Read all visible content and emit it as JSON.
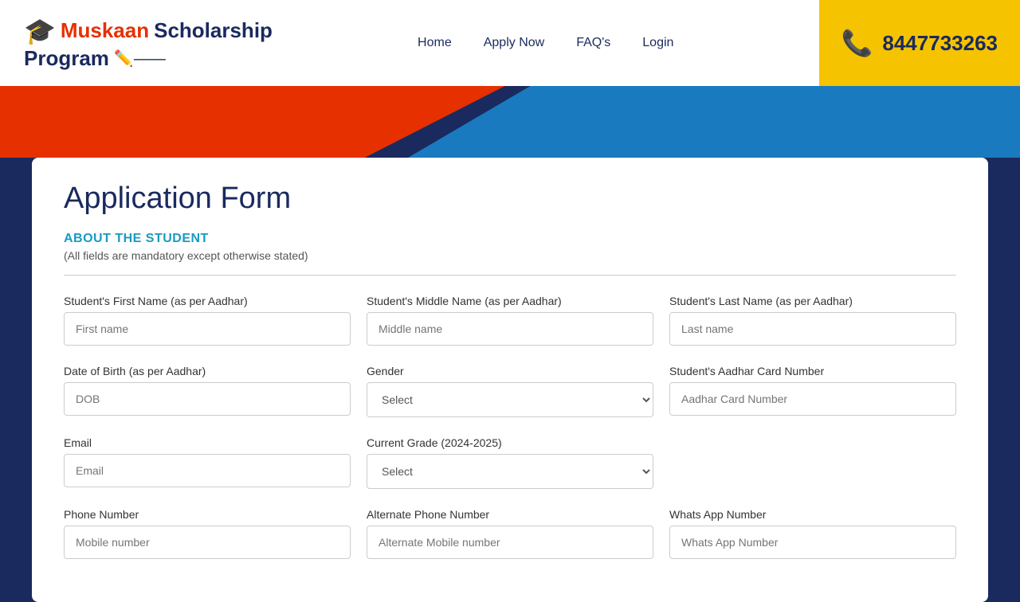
{
  "header": {
    "logo": {
      "muskaan": "Muskaan",
      "scholarship": "Scholarship",
      "program": "Program",
      "cap_icon": "🎓",
      "pencil_icon": "✏️"
    },
    "nav": {
      "items": [
        {
          "label": "Home",
          "active": false
        },
        {
          "label": "Apply Now",
          "active": true
        },
        {
          "label": "FAQ's",
          "active": false
        },
        {
          "label": "Login",
          "active": false
        }
      ]
    },
    "phone": {
      "number": "8447733263",
      "phone_icon": "📞"
    }
  },
  "form": {
    "title": "Application Form",
    "section_title": "ABOUT THE STUDENT",
    "section_note": "(All fields are mandatory except otherwise stated)",
    "fields": {
      "first_name_label": "Student's First Name (as per Aadhar)",
      "first_name_placeholder": "First name",
      "middle_name_label": "Student's Middle Name (as per Aadhar)",
      "middle_name_placeholder": "Middle name",
      "last_name_label": "Student's Last Name (as per Aadhar)",
      "last_name_placeholder": "Last name",
      "dob_label": "Date of Birth (as per Aadhar)",
      "dob_placeholder": "DOB",
      "gender_label": "Gender",
      "gender_placeholder": "Select",
      "aadhar_label": "Student's Aadhar Card Number",
      "aadhar_placeholder": "Aadhar Card Number",
      "email_label": "Email",
      "email_placeholder": "Email",
      "grade_label": "Current Grade (2024-2025)",
      "grade_placeholder": "Select",
      "phone_label": "Phone Number",
      "phone_placeholder": "Mobile number",
      "alt_phone_label": "Alternate Phone Number",
      "alt_phone_placeholder": "Alternate Mobile number",
      "whatsapp_label": "Whats App Number",
      "whatsapp_placeholder": "Whats App Number"
    }
  }
}
